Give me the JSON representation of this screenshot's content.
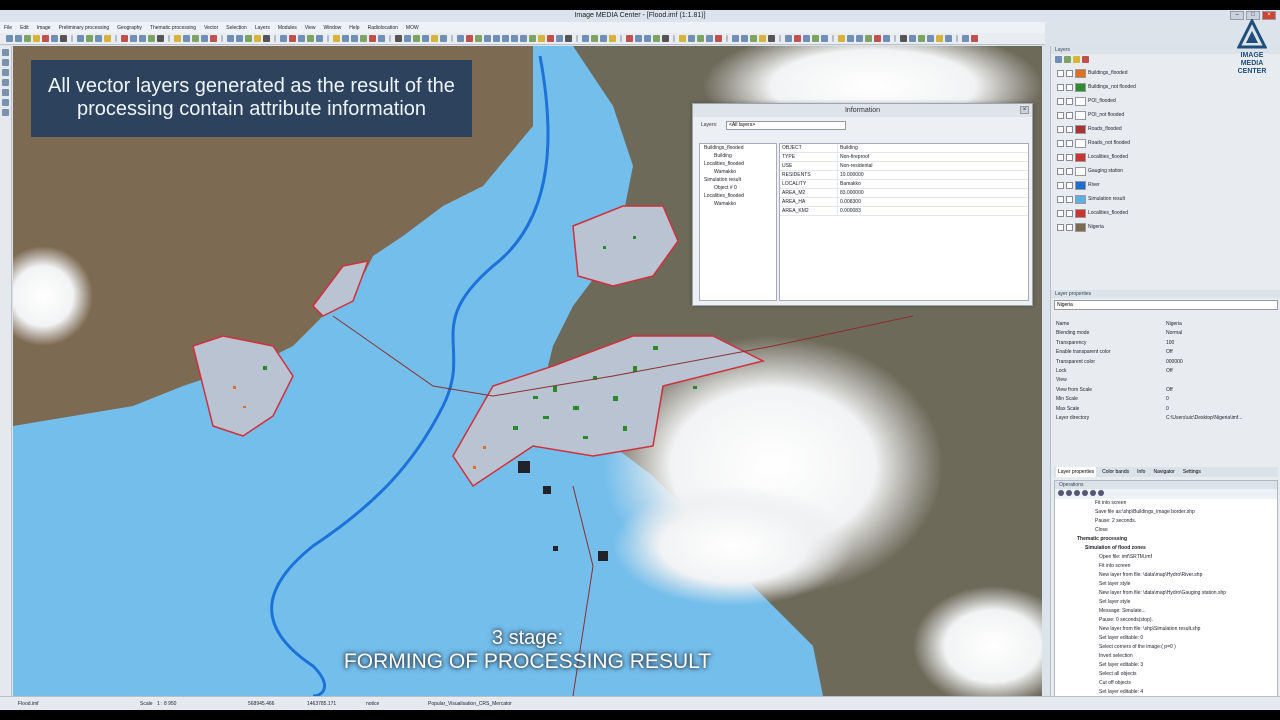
{
  "window": {
    "title": "Image MEDIA Center - [Flood.imf    (1:1.81)]"
  },
  "menu": [
    "File",
    "Edit",
    "Image",
    "Preliminary processing",
    "Geography",
    "Thematic processing",
    "Vector",
    "Selection",
    "Layers",
    "Modules",
    "View",
    "Window",
    "Help",
    "Radiolocation",
    "MOW"
  ],
  "banner": {
    "line1": "All vector layers generated as the result of the",
    "line2": "processing contain attribute information"
  },
  "stage": {
    "line1": "3 stage:",
    "line2": "FORMING OF PROCESSING RESULT"
  },
  "info": {
    "title": "Information",
    "layers_label": "Layers:",
    "layers_value": "<All layers>",
    "tree": [
      "Buildings_flooded",
      "Building",
      "Localities_flooded",
      "Wamakko",
      "Simulation result",
      "Object # 0",
      "Localities_flooded",
      "Wamakko"
    ],
    "attributes": [
      [
        "OBJECT",
        "Building"
      ],
      [
        "TYPE",
        "Non-fireproof"
      ],
      [
        "USE",
        "Non-residental"
      ],
      [
        "RESIDENTS",
        "10.000000"
      ],
      [
        "LOCALITY",
        "Bamakko"
      ],
      [
        "AREA_M2",
        "83.000000"
      ],
      [
        "AREA_HA",
        "0.008300"
      ],
      [
        "AREA_KM2",
        "0.000083"
      ]
    ]
  },
  "layers_panel": {
    "title": "Layers",
    "logo_line1": "IMAGE",
    "logo_line2": "MEDIA",
    "logo_line3": "CENTER",
    "items": [
      {
        "name": "Buildings_flooded",
        "color": "#e07020"
      },
      {
        "name": "Buildings_not flooded",
        "color": "#2e8b2e"
      },
      {
        "name": "POI_flooded",
        "color": "#ffffff"
      },
      {
        "name": "POI_not flooded",
        "color": "#ffffff"
      },
      {
        "name": "Roads_flooded",
        "color": "#a33"
      },
      {
        "name": "Roads_not flooded",
        "color": "#ffffff"
      },
      {
        "name": "Localities_flooded",
        "color": "#c33"
      },
      {
        "name": "Gauging station",
        "color": "#ffffff"
      },
      {
        "name": "River",
        "color": "#1a6fd0"
      },
      {
        "name": "Simulation result",
        "color": "#5ab0e0"
      },
      {
        "name": "Localities_flooded",
        "color": "#c33"
      },
      {
        "name": "Nigeria",
        "color": "#7a6a50"
      }
    ]
  },
  "properties": {
    "title": "Layer properties",
    "selected": "Nigeria",
    "rows": [
      [
        "Name",
        "Nigeria"
      ],
      [
        "Blending mode",
        "Normal"
      ],
      [
        "Transparency",
        "100"
      ],
      [
        "Enable transparent color",
        "Off"
      ],
      [
        "Transparent color",
        "000000"
      ],
      [
        "Lock",
        "Off"
      ],
      [
        "View",
        ""
      ],
      [
        "View from Scale",
        "Off"
      ],
      [
        "Min Scale",
        "0"
      ],
      [
        "Max Scale",
        "0"
      ],
      [
        "Layer directory",
        "C:\\Users\\uic\\Desktop\\Nigeria\\imf..."
      ]
    ]
  },
  "tabs": [
    "Layer properties",
    "Color bands",
    "Info",
    "Navigator",
    "Settings"
  ],
  "operations": {
    "title": "Operations",
    "items": [
      "Fit into screen",
      "Save file as:\\shp\\Buildings_image border.shp",
      "Pause: 2 seconds.",
      "Close",
      "Thematic processing",
      "Simulation of flood zones",
      "Open file: imf\\SRTM.imf",
      "Fit into screen",
      "New layer from file: \\data\\map\\Hydro\\River.shp",
      "Set layer style",
      "New layer from file: \\data\\map\\Hydro\\Gauging station.shp",
      "Set layer style",
      "Message: Simulate...",
      "Pause: 0 seconds(stop).",
      "New layer from file: \\shp\\Simulation result.shp",
      "Set layer editable: 0",
      "Select corners of the image:( p=0 )",
      "Invert selection",
      "Set layer editable: 3",
      "Select all objects",
      "Cut off objects",
      "Set layer editable: 4"
    ]
  },
  "status": {
    "file": "Flood.imf",
    "scale_label": "Scale",
    "scale": "1 : 8 950",
    "x": "568945.466",
    "y": "1463785.171",
    "mode": "notice",
    "crs": "Popular_Visualisation_CRS_Mercator"
  }
}
